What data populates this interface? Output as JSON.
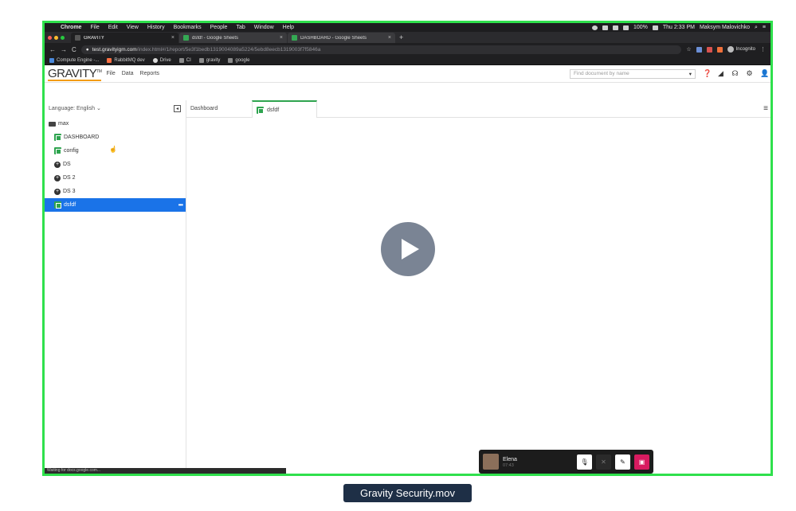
{
  "mac_menubar": {
    "items": [
      "Chrome",
      "File",
      "Edit",
      "View",
      "History",
      "Bookmarks",
      "People",
      "Tab",
      "Window",
      "Help"
    ],
    "battery": "100%",
    "clock": "Thu 2:33 PM",
    "user": "Maksym Malovichko"
  },
  "browser": {
    "tabs": [
      {
        "title": "GRAVITY",
        "active": true
      },
      {
        "title": "dsfdf - Google Sheets",
        "active": false
      },
      {
        "title": "DASHBOARD - Google Sheets",
        "active": false
      }
    ],
    "new_tab": "+",
    "close_glyph": "×",
    "url_host": "test.gravityigm.com",
    "url_path": "/index.html#/1/report/5e3f1bedb1319004089a5224/5ebd8eecb1319003f7f5846a",
    "profile_label": "Incognito",
    "bookmarks": [
      "Compute Engine -...",
      "RabbitMQ dev",
      "Drive",
      "CI",
      "gravity",
      "google"
    ]
  },
  "app": {
    "logo": "GRAVITY",
    "logo_tm": "TM",
    "menu": [
      "File",
      "Data",
      "Reports"
    ],
    "search_placeholder": "Find document by name",
    "language_label": "Language: English ⌄",
    "tree": {
      "root": "max",
      "items": [
        {
          "label": "DASHBOARD",
          "type": "sheet"
        },
        {
          "label": "config",
          "type": "sheet"
        },
        {
          "label": "DS",
          "type": "source"
        },
        {
          "label": "DS 2",
          "type": "source"
        },
        {
          "label": "DS 3",
          "type": "source"
        },
        {
          "label": "dsfdf",
          "type": "sheet",
          "selected": true
        }
      ],
      "more_glyph": "•••"
    },
    "tabs": [
      {
        "label": "Dashboard",
        "active": false
      },
      {
        "label": "dsfdf",
        "active": true
      }
    ],
    "status_url": "Waiting for docs.google.com..."
  },
  "call_widget": {
    "name": "Elena",
    "time": "07:43"
  },
  "caption": "Gravity Security.mov",
  "colors": {
    "frame_border": "#2fe04c",
    "selection": "#1a73e8",
    "sheet_green": "#2ea44f",
    "caption_bg": "#1e2f46"
  }
}
